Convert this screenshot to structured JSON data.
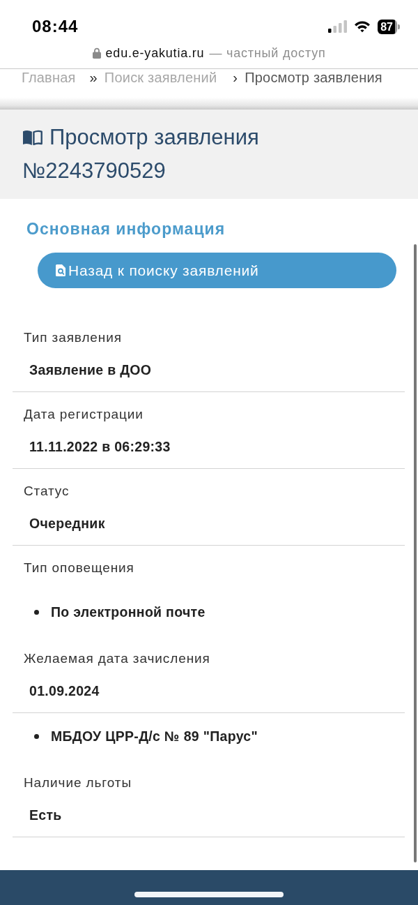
{
  "status_bar": {
    "time": "08:44",
    "battery": "87"
  },
  "address_bar": {
    "domain": "edu.e-yakutia.ru",
    "note": "— частный доступ"
  },
  "breadcrumb": [
    {
      "label": "Главная",
      "current": false
    },
    {
      "separator": "»",
      "label": "Поиск заявлений",
      "current": false
    },
    {
      "separator": "›",
      "label": "Просмотр заявления",
      "current": true
    }
  ],
  "page_header": {
    "title": "Просмотр заявления",
    "number": "№2243790529"
  },
  "section": {
    "title": "Основная информация",
    "back_button": "Назад к поиску заявлений"
  },
  "fields": [
    {
      "kind": "value",
      "label": "Тип заявления",
      "value": "Заявление в ДОО"
    },
    {
      "kind": "value",
      "label": "Дата регистрации",
      "value": "11.11.2022 в 06:29:33"
    },
    {
      "kind": "value",
      "label": "Статус",
      "value": "Очередник"
    },
    {
      "kind": "list",
      "label": "Тип оповещения",
      "items": [
        "По электронной почте"
      ]
    },
    {
      "kind": "value",
      "label": "Желаемая дата зачисления",
      "value": "01.09.2024"
    },
    {
      "kind": "list",
      "items": [
        "МБДОУ ЦРР-Д/с № 89 \"Парус\""
      ]
    },
    {
      "kind": "value",
      "label": "Наличие льготы",
      "value": "Есть"
    }
  ]
}
